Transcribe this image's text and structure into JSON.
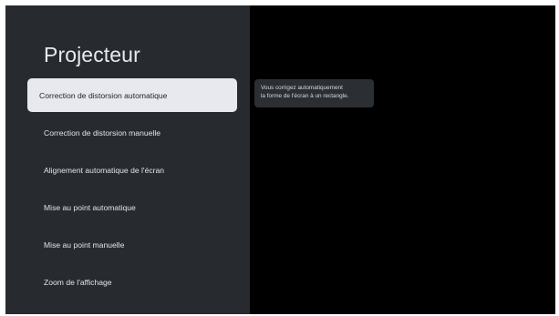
{
  "panel": {
    "title": "Projecteur"
  },
  "menu": {
    "selected_index": 0,
    "items": [
      {
        "label": "Correction de distorsion automatique"
      },
      {
        "label": "Correction de distorsion manuelle"
      },
      {
        "label": "Alignement automatique de l'écran"
      },
      {
        "label": "Mise au point automatique"
      },
      {
        "label": "Mise au point manuelle"
      },
      {
        "label": "Zoom de l'affichage"
      }
    ]
  },
  "tooltip": {
    "line1": "Vous corrigez automatiquement",
    "line2": "la forme de l'écran à un rectangle."
  },
  "colors": {
    "panel_background": "#272a2f",
    "screen_background": "#000000",
    "selected_item_background": "#e8e9ee",
    "tooltip_background": "#2b2e33"
  }
}
